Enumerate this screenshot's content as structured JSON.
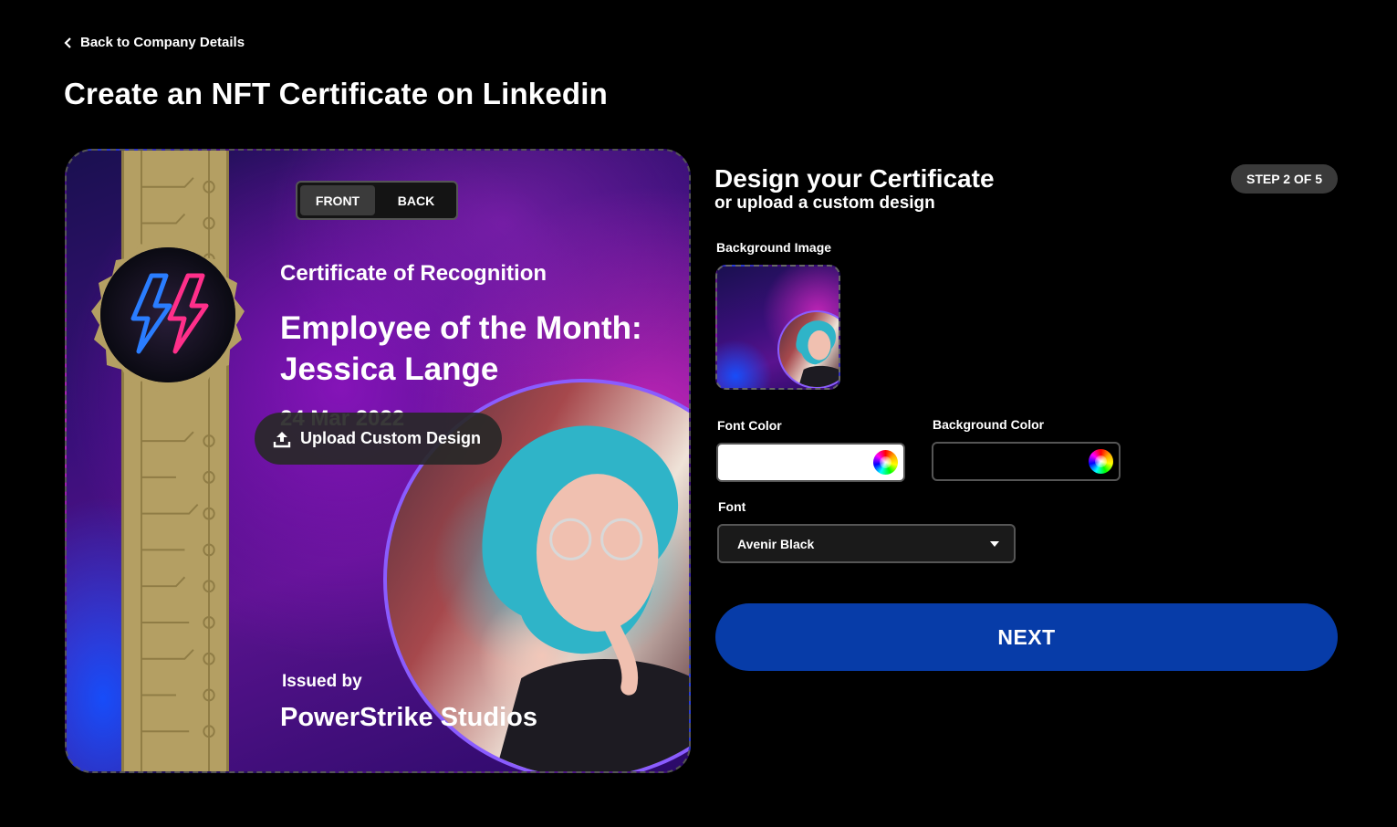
{
  "nav": {
    "back_label": "Back to Company Details"
  },
  "page": {
    "title": "Create an NFT Certificate on Linkedin"
  },
  "certificate": {
    "face_toggle": {
      "front_label": "FRONT",
      "back_label": "BACK",
      "active": "FRONT"
    },
    "subtitle": "Certificate of Recognition",
    "title": "Employee of the Month: Jessica Lange",
    "date_partial": "24 Mar 2022",
    "issued_by_label": "Issued by",
    "issuer": "PowerStrike Studios",
    "upload_label": "Upload Custom Design",
    "colors": {
      "ribbon": "#b49f63",
      "portrait_ring": "#8a5cff"
    }
  },
  "panel": {
    "title": "Design your Certificate",
    "subtitle": "or upload a custom design",
    "step_badge": "STEP 2 OF 5",
    "background_image_label": "Background Image",
    "font_color_label": "Font Color",
    "font_color_value": "#ffffff",
    "background_color_label": "Background Color",
    "background_color_value": "#000000",
    "font_label": "Font",
    "font_value": "Avenir Black",
    "next_label": "NEXT"
  },
  "theme": {
    "accent": "#073ca8",
    "page_bg": "#000000"
  }
}
